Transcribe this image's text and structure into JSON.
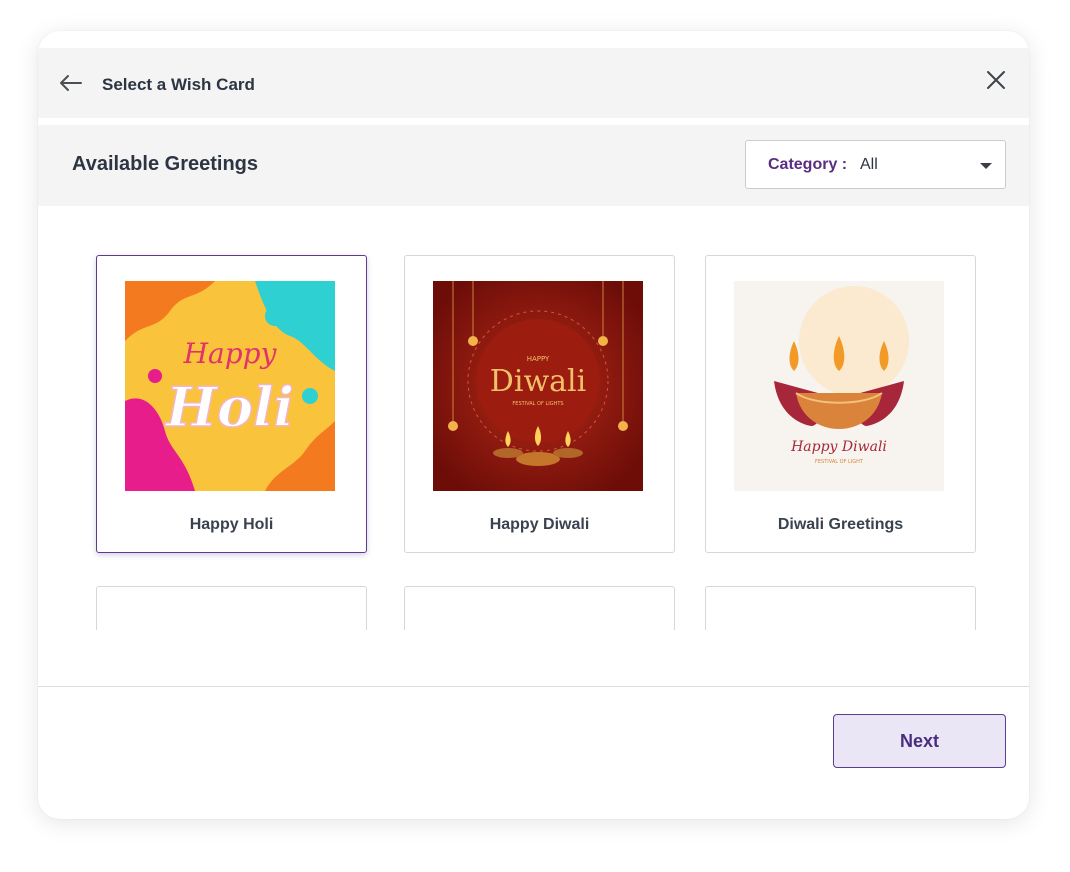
{
  "modal": {
    "title": "Select a Wish Card"
  },
  "greetings": {
    "section_title": "Available Greetings",
    "category": {
      "label": "Category :",
      "value": "All"
    },
    "cards": [
      {
        "label": "Happy Holi",
        "selected": true
      },
      {
        "label": "Happy Diwali",
        "selected": false
      },
      {
        "label": "Diwali Greetings",
        "selected": false
      }
    ],
    "art": {
      "holi_line1": "Happy",
      "holi_line2": "Holi",
      "diwali_small": "HAPPY",
      "diwali_big": "Diwali",
      "diwali_sub": "FESTIVAL OF LIGHTS",
      "greet_line1": "Happy Diwali",
      "greet_line2": "FESTIVAL OF LIGHT"
    }
  },
  "footer": {
    "next_label": "Next"
  },
  "colors": {
    "accent": "#5a3c91",
    "next_bg": "#ebe6f5"
  },
  "icons": {
    "back": "arrow-left-icon",
    "close": "close-icon",
    "dropdown": "chevron-down-icon"
  }
}
